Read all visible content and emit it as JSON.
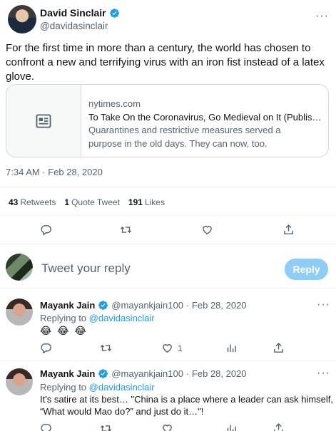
{
  "main_tweet": {
    "author_name": "David Sinclair",
    "handle": "@davidasinclair",
    "text": "For the first time in more than a century, the world has chosen to confront a new and terrifying virus with an iron fist instead of a latex glove.",
    "card": {
      "domain": "nytimes.com",
      "title": "To Take On the Coronavirus, Go Medieval on It (Published ...",
      "description": "Quarantines and restrictive measures served a purpose in the old days. They can now, too."
    },
    "timestamp": "7:34 AM · Feb 28, 2020",
    "stats": {
      "retweets_count": "43",
      "retweets_label": "Retweets",
      "quotes_count": "1",
      "quotes_label": "Quote Tweet",
      "likes_count": "191",
      "likes_label": "Likes"
    },
    "icons": [
      "reply-icon",
      "retweet-icon",
      "like-icon",
      "share-icon"
    ]
  },
  "composer": {
    "placeholder": "Tweet your reply",
    "button_label": "Reply"
  },
  "replies": [
    {
      "name": "Mayank Jain",
      "handle": "@mayankjain100",
      "date": "· Feb 28, 2020",
      "replying_prefix": "Replying to",
      "replying_handle": "@davidasinclair",
      "text": "😂 😂 😂",
      "like_count": "1"
    },
    {
      "name": "Mayank Jain",
      "handle": "@mayankjain100",
      "date": "· Feb 28, 2020",
      "replying_prefix": "Replying to",
      "replying_handle": "@davidasinclair",
      "text_line1": "It's satire at its best… \"China is a place where a leader can ask himself,",
      "text_line2": "“What would Mao do?” and just do it…\"!"
    }
  ],
  "colors": {
    "accent": "#1d9bf0",
    "reply_button_disabled": "#8ecdf7",
    "muted_text": "#536471",
    "border": "#cfd9de"
  }
}
